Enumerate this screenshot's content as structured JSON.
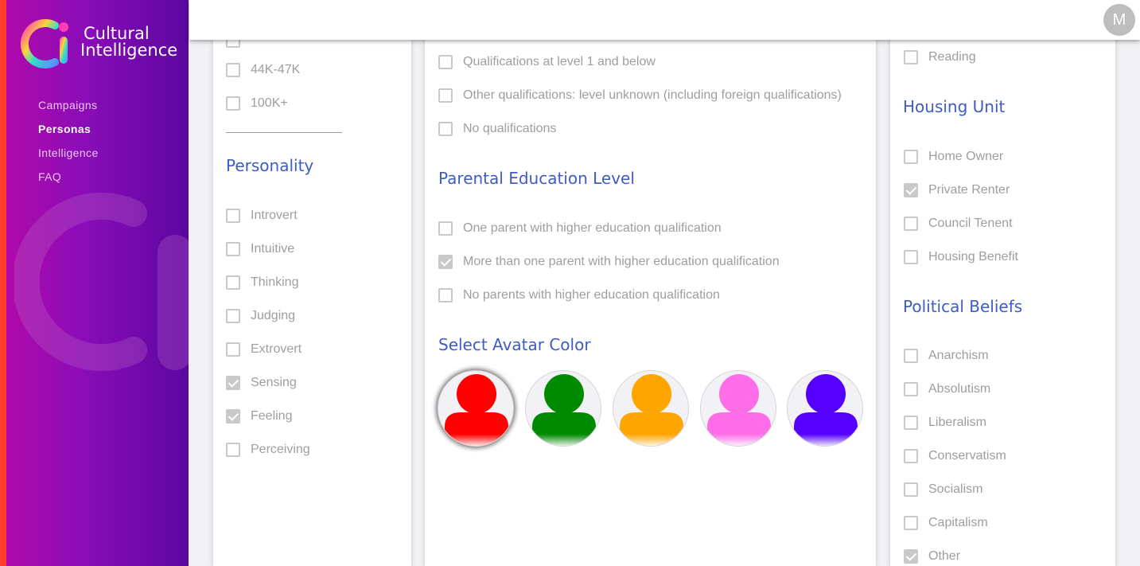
{
  "brand": {
    "line1": "Cultural",
    "line2": "Intelligence"
  },
  "nav": [
    {
      "label": "Campaigns",
      "active": false
    },
    {
      "label": "Personas",
      "active": true
    },
    {
      "label": "Intelligence",
      "active": false
    },
    {
      "label": "FAQ",
      "active": false
    }
  ],
  "header": {
    "user_initial": "M"
  },
  "left_panel": {
    "income_options": [
      {
        "label": "44K-47K",
        "checked": false
      },
      {
        "label": "100K+",
        "checked": false
      }
    ],
    "personality_title": "Personality",
    "personality_options": [
      {
        "label": "Introvert",
        "checked": false
      },
      {
        "label": "Intuitive",
        "checked": false
      },
      {
        "label": "Thinking",
        "checked": false
      },
      {
        "label": "Judging",
        "checked": false
      },
      {
        "label": "Extrovert",
        "checked": false
      },
      {
        "label": "Sensing",
        "checked": true
      },
      {
        "label": "Feeling",
        "checked": true
      },
      {
        "label": "Perceiving",
        "checked": false
      }
    ]
  },
  "middle_panel": {
    "qualification_options": [
      {
        "label": "Qualifications at level 1 and below",
        "checked": false
      },
      {
        "label": "Other qualifications: level unknown (including foreign qualifications)",
        "checked": false
      },
      {
        "label": "No qualifications",
        "checked": false
      }
    ],
    "parental_title": "Parental Education Level",
    "parental_options": [
      {
        "label": "One parent with higher education qualification",
        "checked": false
      },
      {
        "label": "More than one parent with higher education qualification",
        "checked": true
      },
      {
        "label": "No parents with higher education qualification",
        "checked": false
      }
    ],
    "avatar_title": "Select Avatar Color",
    "avatar_colors": [
      {
        "color": "#ff0000",
        "selected": true
      },
      {
        "color": "#008a00",
        "selected": false
      },
      {
        "color": "#ffa500",
        "selected": false
      },
      {
        "color": "#ff6ee8",
        "selected": false
      },
      {
        "color": "#5500ff",
        "selected": false
      }
    ]
  },
  "right_panel": {
    "hobby_options": [
      {
        "label": "Reading",
        "checked": false
      }
    ],
    "housing_title": "Housing Unit",
    "housing_options": [
      {
        "label": "Home Owner",
        "checked": false
      },
      {
        "label": "Private Renter",
        "checked": true
      },
      {
        "label": "Council Tenent",
        "checked": false
      },
      {
        "label": "Housing Benefit",
        "checked": false
      }
    ],
    "political_title": "Political Beliefs",
    "political_options": [
      {
        "label": "Anarchism",
        "checked": false
      },
      {
        "label": "Absolutism",
        "checked": false
      },
      {
        "label": "Liberalism",
        "checked": false
      },
      {
        "label": "Conservatism",
        "checked": false
      },
      {
        "label": "Socialism",
        "checked": false
      },
      {
        "label": "Capitalism",
        "checked": false
      },
      {
        "label": "Other",
        "checked": true
      }
    ]
  }
}
